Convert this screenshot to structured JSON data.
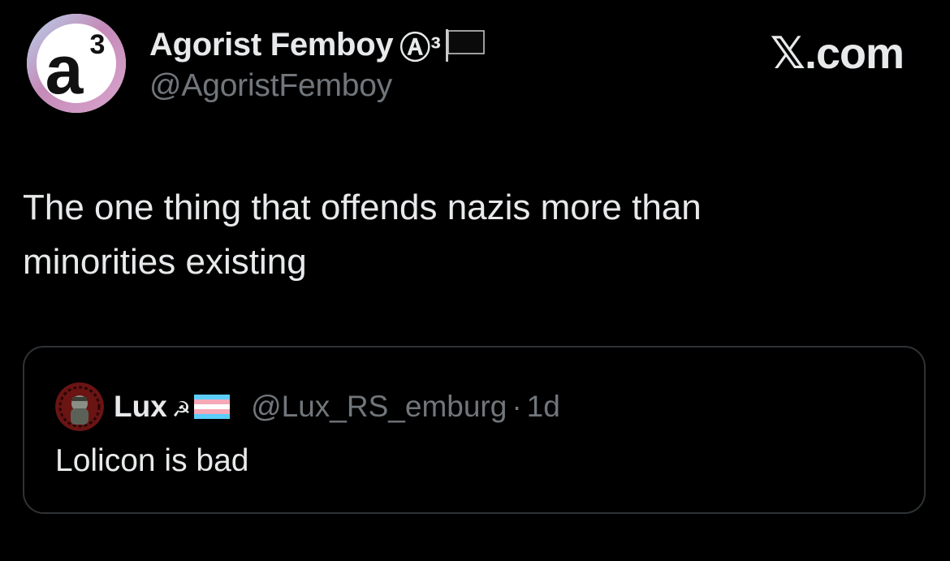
{
  "tweet": {
    "author": {
      "display_name": "Agorist Femboy",
      "name_badges": "Ⓐ³",
      "flag_icon": "black-flag-icon",
      "handle": "@AgoristFemboy",
      "avatar_icon": "a3-logo-icon"
    },
    "brand_label": "𝕏.com",
    "text": "The one thing that offends nazis more than\nminorities existing",
    "quote": {
      "avatar_icon": "lux-avatar-icon",
      "display_name": "Lux",
      "name_symbol": "☭",
      "flag_icon": "trans-flag-icon",
      "handle": "@Lux_RS_emburg",
      "separator": "·",
      "time": "1d",
      "text": "Lolicon is bad"
    }
  },
  "colors": {
    "background": "#000000",
    "primary_text": "#e7e9ea",
    "secondary_text": "#71767b",
    "card_border": "#2f3336",
    "trans_blue": "#5bcefa",
    "trans_pink": "#f5a9b8",
    "avatar_ring_pink": "#c58ab8"
  }
}
